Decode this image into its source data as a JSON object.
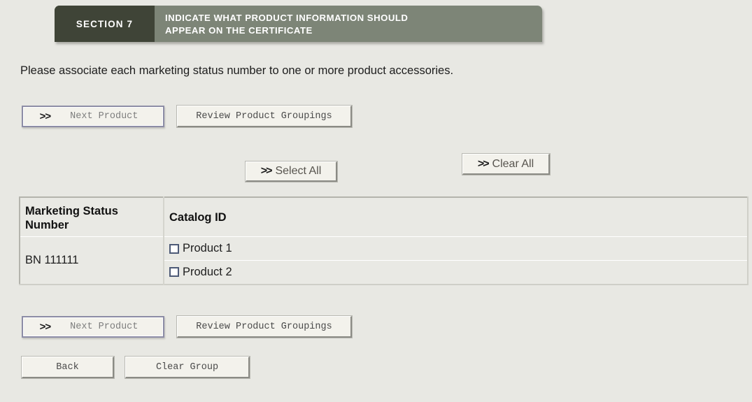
{
  "header": {
    "section_label": "SECTION 7",
    "title_line1": "INDICATE WHAT PRODUCT INFORMATION SHOULD",
    "title_line2": "APPEAR ON THE CERTIFICATE",
    "section_bg": "#3f4437",
    "banner_bg": "#7d8577"
  },
  "page": {
    "background": "#e8e8e3",
    "instruction": "Please associate each marketing status number to one or more product accessories."
  },
  "toolbar_top": {
    "next_product_label": "Next Product",
    "next_product_chevron": ">>",
    "review_groupings_label": "Review Product Groupings"
  },
  "selection_controls": {
    "select_all_label": "Select All",
    "select_all_chevron": ">>",
    "clear_all_label": "Clear All",
    "clear_all_chevron": ">>"
  },
  "table": {
    "headers": [
      "Marketing Status Number",
      "Catalog ID"
    ],
    "header_col1_line1": "Marketing Status",
    "header_col1_line2": "Number",
    "header_col2": "Catalog ID",
    "rows": [
      {
        "marketing_status_number": "BN 111111",
        "items": [
          {
            "label": "Product 1",
            "checked": false
          },
          {
            "label": "Product 2",
            "checked": false
          }
        ]
      }
    ]
  },
  "toolbar_bottom": {
    "next_product_label": "Next Product",
    "next_product_chevron": ">>",
    "review_groupings_label": "Review Product Groupings",
    "back_label": "Back",
    "clear_group_label": "Clear Group"
  }
}
